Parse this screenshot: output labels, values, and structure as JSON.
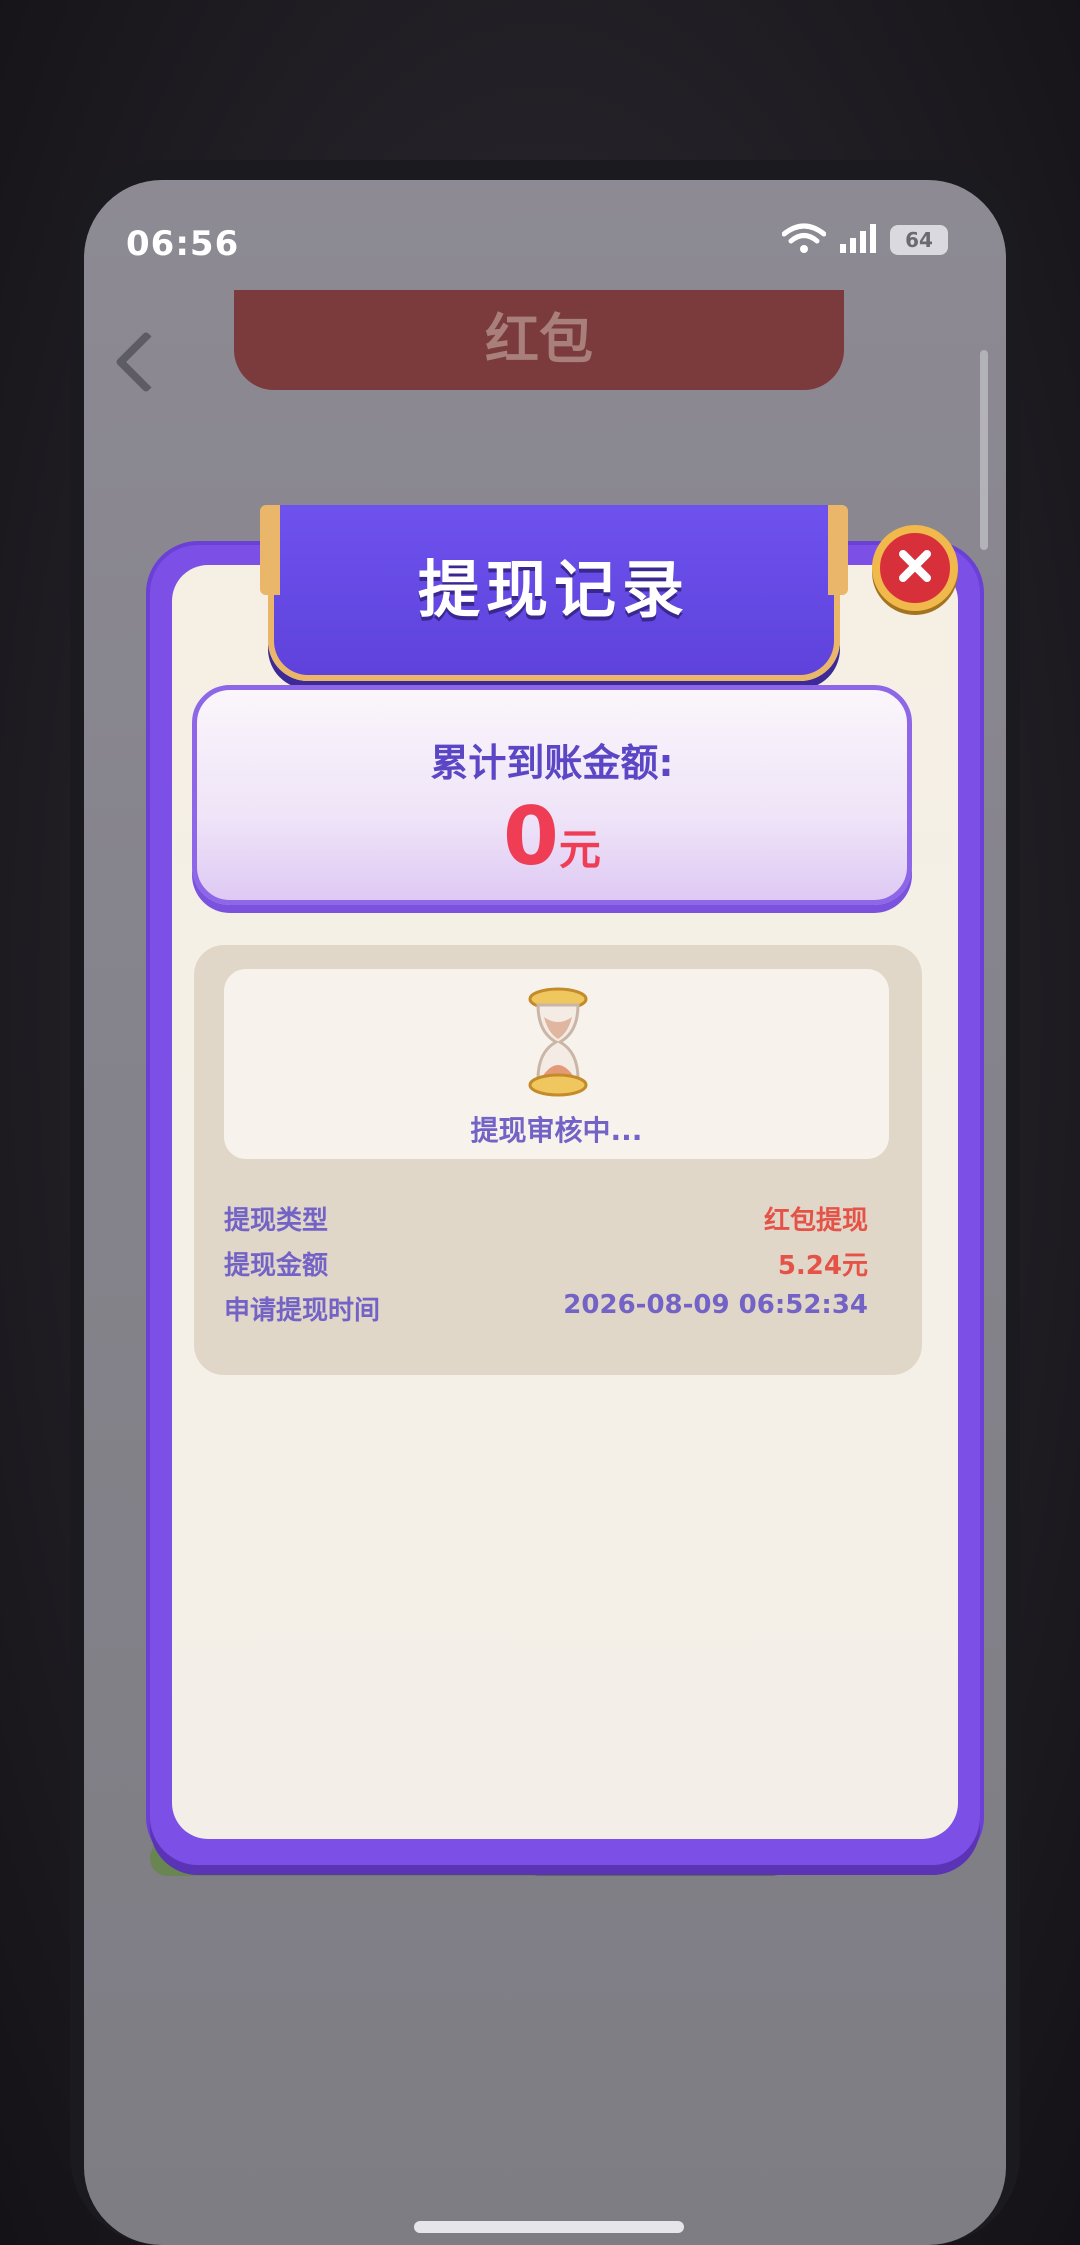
{
  "status_bar": {
    "time": "06:56",
    "battery": "64",
    "icons": [
      "wifi-icon",
      "signal-icon",
      "battery-icon"
    ]
  },
  "background_app": {
    "title": "红包"
  },
  "dialog": {
    "title": "提现记录",
    "close_icon": "close-icon",
    "total": {
      "label": "累计到账金额:",
      "amount": "0",
      "unit": "元"
    },
    "record": {
      "status_icon": "hourglass-icon",
      "status_text": "提现审核中...",
      "rows": [
        {
          "label": "提现类型",
          "value": "红包提现",
          "highlight": true
        },
        {
          "label": "提现金额",
          "value": "5.24元",
          "highlight": true
        },
        {
          "label": "申请提现时间",
          "value": "2026-08-09 06:52:34",
          "highlight": false
        }
      ]
    }
  },
  "colors": {
    "accent_purple": "#7c4fe6",
    "amount_red": "#ef3d55",
    "close_red": "#d8303a",
    "gold_border": "#e9b66a"
  }
}
